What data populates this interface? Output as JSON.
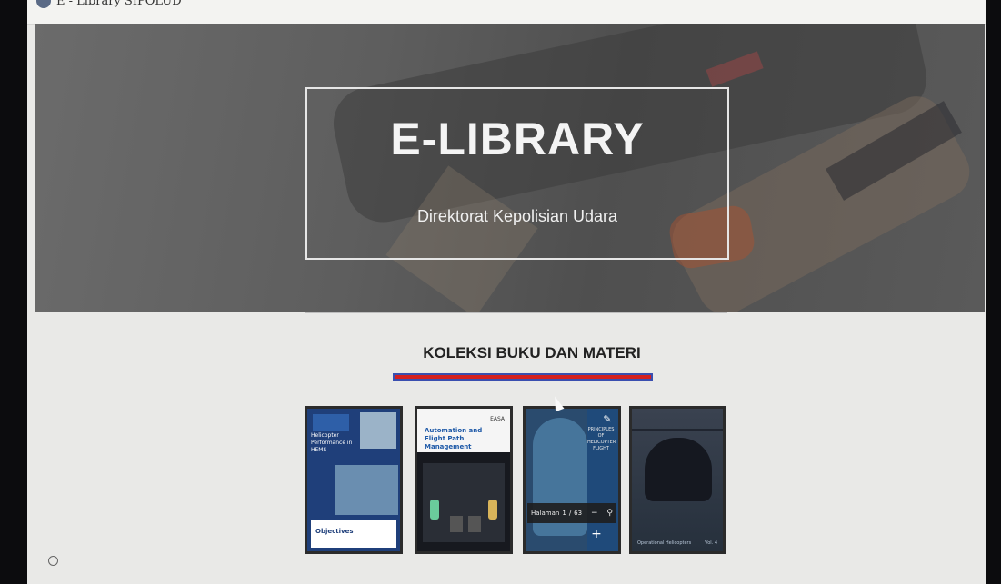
{
  "header": {
    "brand_text": "E - Library SIPOLUD",
    "brand_icon": "logo-icon"
  },
  "hero": {
    "title": "E-LIBRARY",
    "subtitle": "Direktorat Kepolisian Udara"
  },
  "section": {
    "title": "KOLEKSI BUKU DAN MATERI",
    "underline_color": "#d42020"
  },
  "books": [
    {
      "title": "Helicopter Performance in HEMS",
      "section_label": "Objectives"
    },
    {
      "title": "Automation and Flight Path Management",
      "logo": "EASA"
    },
    {
      "title": "PRINCIPLES OF HELICOPTER FLIGHT",
      "pager": {
        "label": "Halaman",
        "current": "1",
        "separator": "/",
        "total": "63"
      },
      "icons": [
        "edit-icon",
        "zoom-out-icon",
        "zoom-in-icon",
        "plus-icon"
      ]
    },
    {
      "title": "",
      "caption": "Operational Helicopters",
      "page": "Vol. 4"
    }
  ]
}
